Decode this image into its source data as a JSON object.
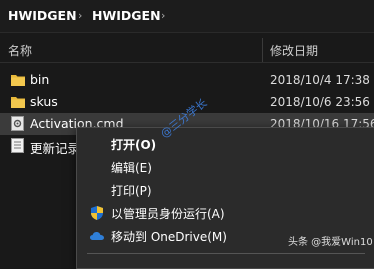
{
  "breadcrumb": {
    "items": [
      "HWIDGEN",
      "HWIDGEN"
    ],
    "separator": "›"
  },
  "columns": {
    "name": "名称",
    "date_modified": "修改日期"
  },
  "files": [
    {
      "name": "bin",
      "date": "2018/10/4 17:38",
      "type": "folder"
    },
    {
      "name": "skus",
      "date": "2018/10/6 23:56",
      "type": "folder"
    },
    {
      "name": "Activation.cmd",
      "date": "2018/10/16 17:56",
      "type": "cmd",
      "selected": true
    },
    {
      "name": "更新记录",
      "date": "",
      "type": "text"
    }
  ],
  "context_menu": {
    "items": [
      {
        "label": "打开(O)",
        "bold": true,
        "icon": ""
      },
      {
        "label": "编辑(E)",
        "bold": false,
        "icon": ""
      },
      {
        "label": "打印(P)",
        "bold": false,
        "icon": ""
      },
      {
        "label": "以管理员身份运行(A)",
        "bold": false,
        "icon": "uac-shield-icon"
      },
      {
        "label": "移动到 OneDrive(M)",
        "bold": false,
        "icon": "onedrive-cloud-icon"
      }
    ]
  },
  "watermarks": {
    "stamp": "@三分学长",
    "credit": "头条 @我爱Win10"
  },
  "colors": {
    "background": "#191919",
    "selected_row": "#3b3b3b",
    "menu_background": "#2b2b2b",
    "folder": "#e8b93a",
    "onedrive": "#2f7fd8",
    "watermark_blue": "#3d7fe0"
  }
}
